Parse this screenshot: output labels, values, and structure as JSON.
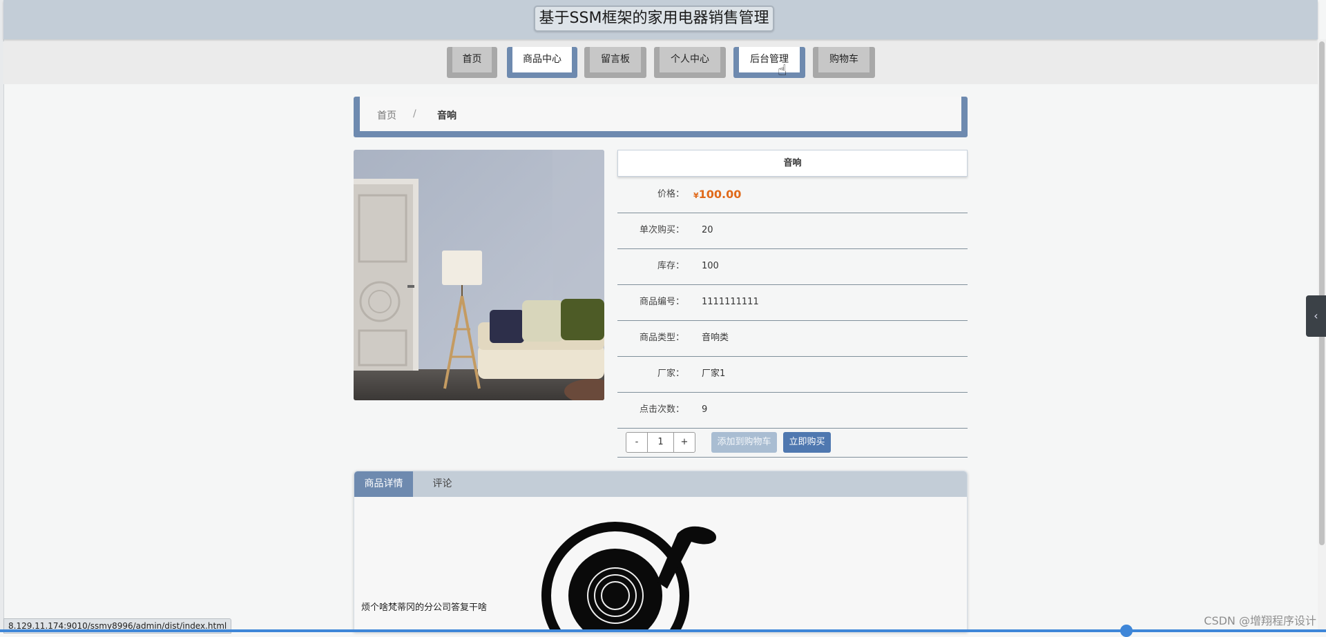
{
  "site": {
    "title": "基于SSM框架的家用电器销售管理"
  },
  "nav": {
    "items": [
      {
        "label": "首页",
        "style": "gray"
      },
      {
        "label": "商品中心",
        "style": "blue"
      },
      {
        "label": "留言板",
        "style": "gray"
      },
      {
        "label": "个人中心",
        "style": "gray"
      },
      {
        "label": "后台管理",
        "style": "blue"
      },
      {
        "label": "购物车",
        "style": "gray"
      }
    ]
  },
  "breadcrumb": {
    "home": "首页",
    "separator": "/",
    "current": "音响"
  },
  "product": {
    "name": "音响",
    "price_label": "价格：",
    "currency": "¥",
    "price": "100.00",
    "rows": [
      {
        "label": "单次购买：",
        "value": "20"
      },
      {
        "label": "库存：",
        "value": "100"
      },
      {
        "label": "商品编号：",
        "value": "1111111111"
      },
      {
        "label": "商品类型：",
        "value": "音响类"
      },
      {
        "label": "厂家：",
        "value": "厂家1"
      },
      {
        "label": "点击次数：",
        "value": "9"
      }
    ],
    "quantity": {
      "minus": "-",
      "value": "1",
      "plus": "+"
    },
    "add_to_cart_label": "添加到购物车",
    "buy_now_label": "立即购买"
  },
  "tabs": {
    "active": "商品详情",
    "inactive": "评论"
  },
  "detail": {
    "text": "烦个啥梵蒂冈的分公司答复干啥"
  },
  "status": {
    "url": "8.129.11.174:9010/ssmy8996/admin/dist/index.html"
  },
  "watermark": "CSDN @增翔程序设计",
  "colors": {
    "accent": "#6e8aaf",
    "header": "#c3cdd7",
    "price": "#e06a1b",
    "buy_button": "#4f78b0"
  }
}
